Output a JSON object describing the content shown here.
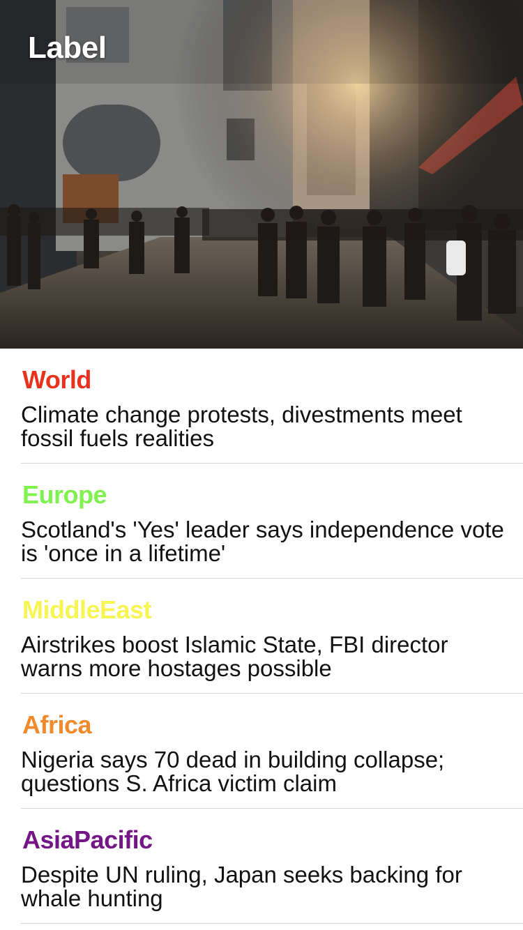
{
  "header": {
    "title": "Label"
  },
  "colors": {
    "world": "#e8321e",
    "europe": "#7ff24f",
    "middleeast": "#f6f553",
    "africa": "#ef8a2d",
    "asiapacific": "#741686"
  },
  "articles": [
    {
      "category": "World",
      "headline": "Climate change protests, divestments meet fossil fuels realities"
    },
    {
      "category": "Europe",
      "headline": "Scotland's 'Yes' leader says independence vote is 'once in a lifetime'"
    },
    {
      "category": "MiddleEast",
      "headline": "Airstrikes boost Islamic State, FBI director warns more hostages possible"
    },
    {
      "category": "Africa",
      "headline": "Nigeria says 70 dead in building collapse; questions S. Africa victim claim"
    },
    {
      "category": "AsiaPacific",
      "headline": "Despite UN ruling, Japan seeks backing for whale hunting"
    }
  ]
}
